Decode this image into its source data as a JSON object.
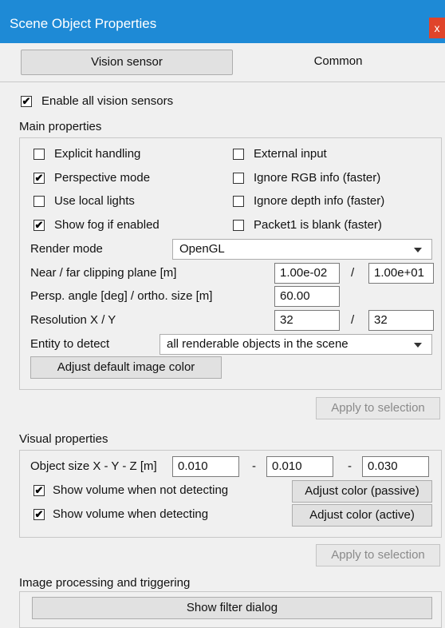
{
  "window": {
    "title": "Scene Object Properties",
    "close_glyph": "x"
  },
  "tabs": [
    {
      "label": "Vision sensor",
      "active": true
    },
    {
      "label": "Common",
      "active": false
    }
  ],
  "enable_all": {
    "label": "Enable all vision sensors",
    "checked": true
  },
  "main": {
    "heading": "Main properties",
    "checkboxes": [
      {
        "label": "Explicit handling",
        "checked": false
      },
      {
        "label": "External input",
        "checked": false
      },
      {
        "label": "Perspective mode",
        "checked": true
      },
      {
        "label": "Ignore RGB info (faster)",
        "checked": false
      },
      {
        "label": "Use local lights",
        "checked": false
      },
      {
        "label": "Ignore depth  info (faster)",
        "checked": false
      },
      {
        "label": "Show fog if enabled",
        "checked": true
      },
      {
        "label": "Packet1 is blank (faster)",
        "checked": false
      }
    ],
    "render_mode_label": "Render mode",
    "render_mode_value": "OpenGL",
    "clipping_label": "Near / far clipping plane [m]",
    "near_value": "1.00e-02",
    "far_value": "1.00e+01",
    "angle_label": "Persp. angle [deg] / ortho. size [m]",
    "angle_value": "60.00",
    "resolution_label": "Resolution X / Y",
    "res_x": "32",
    "res_y": "32",
    "entity_label": "Entity to detect",
    "entity_value": "all renderable objects in the scene",
    "adjust_color_button": "Adjust default image color",
    "apply_button": "Apply to selection",
    "slash": "/"
  },
  "visual": {
    "heading": "Visual properties",
    "size_label": "Object size X - Y - Z [m]",
    "size_x": "0.010",
    "size_y": "0.010",
    "size_z": "0.030",
    "dash": "-",
    "show_not_detecting": {
      "label": "Show volume when not detecting",
      "checked": true
    },
    "show_detecting": {
      "label": "Show volume when detecting",
      "checked": true
    },
    "adjust_passive": "Adjust color (passive)",
    "adjust_active": "Adjust color (active)",
    "apply_button": "Apply to selection"
  },
  "image_processing": {
    "heading": "Image processing and triggering",
    "filter_button": "Show filter dialog"
  },
  "check_glyph": "✔"
}
